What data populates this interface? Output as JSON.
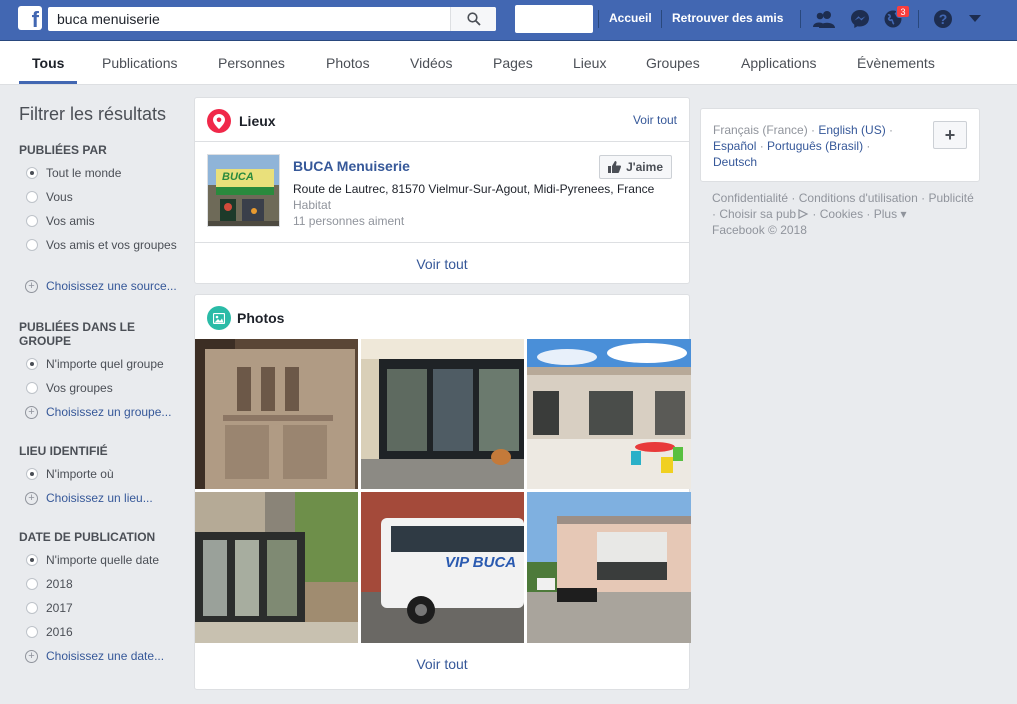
{
  "topbar": {
    "logo": "f",
    "search_value": "buca menuiserie",
    "nav_home": "Accueil",
    "nav_find_friends": "Retrouver des amis",
    "notif_count": "3"
  },
  "tabs": [
    "Tous",
    "Publications",
    "Personnes",
    "Photos",
    "Vidéos",
    "Pages",
    "Lieux",
    "Groupes",
    "Applications",
    "Évènements"
  ],
  "filters": {
    "title": "Filtrer les résultats",
    "s1_title": "PUBLIÉES PAR",
    "s1_items": [
      "Tout le monde",
      "Vous",
      "Vos amis",
      "Vos amis et vos groupes"
    ],
    "s1_link": "Choisissez une source...",
    "s2_title": "PUBLIÉES DANS LE GROUPE",
    "s2_items": [
      "N'importe quel groupe",
      "Vos groupes"
    ],
    "s2_link": "Choisissez un groupe...",
    "s3_title": "LIEU IDENTIFIÉ",
    "s3_items": [
      "N'importe où"
    ],
    "s3_link": "Choisissez un lieu...",
    "s4_title": "DATE DE PUBLICATION",
    "s4_items": [
      "N'importe quelle date",
      "2018",
      "2017",
      "2016"
    ],
    "s4_link": "Choisissez une date..."
  },
  "places": {
    "title": "Lieux",
    "see_all_header": "Voir tout",
    "name": "BUCA Menuiserie",
    "address": "Route de Lautrec, 81570 Vielmur-Sur-Agout, Midi-Pyrenees, France",
    "category": "Habitat",
    "likes": "11 personnes aiment",
    "like_button": "J'aime",
    "see_all": "Voir tout",
    "thumb_text": "BUCA"
  },
  "photos": {
    "title": "Photos",
    "see_all": "Voir tout",
    "bus_text": "VIP BUCA"
  },
  "languages": {
    "current": "Français (France)",
    "others": [
      "English (US)",
      "Español",
      "Português (Brasil)",
      "Deutsch"
    ]
  },
  "footer": {
    "links": [
      "Confidentialité",
      "Conditions d'utilisation",
      "Publicité",
      "Choisir sa pub",
      "Cookies",
      "Plus"
    ],
    "copyright": "Facebook © 2018"
  },
  "colors": {
    "brand": "#4267b2",
    "link": "#365899",
    "places_icon": "#f02849",
    "photos_icon": "#2abba7"
  }
}
